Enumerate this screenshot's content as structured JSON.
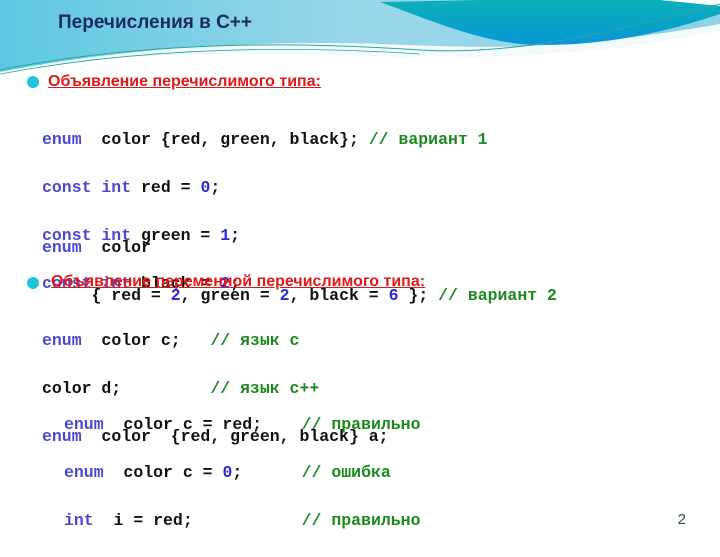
{
  "slide": {
    "title": "Перечисления в С++",
    "page_number": "2",
    "colors": {
      "title": "#1a2a5e",
      "heading": "#e01818",
      "keyword": "#4a4ad0",
      "number": "#2a2ad8",
      "comment": "#1e8a1e",
      "bullet": "#1fc4d8"
    }
  },
  "section1": {
    "heading": " Объявление перечислимого типа:",
    "lines": [
      {
        "kw": "enum",
        "text": "  color {red, green, black}; ",
        "comment": "// вариант 1"
      },
      {
        "kw": "const int",
        "text": " red = ",
        "num": "0",
        "tail": ";"
      },
      {
        "kw": "const int",
        "text": " green = ",
        "num": "1",
        "tail": ";"
      },
      {
        "kw": "const int",
        "text": " black = ",
        "num": "2",
        "tail": ";"
      }
    ],
    "variant2": {
      "kw": "enum",
      "line1": "  color",
      "line2_a": "     { red = ",
      "n1": "2",
      "line2_b": ", green = ",
      "n2": "2",
      "line2_c": ", black = ",
      "n3": "6",
      "line2_d": " }; ",
      "comment": "// вариант 2"
    }
  },
  "section2": {
    "heading": "Объявление переменной перечислимого типа:",
    "lines": [
      {
        "kw": "enum",
        "text": "  color c;   ",
        "comment": "// язык с"
      },
      {
        "kw": "",
        "text": "color d;         ",
        "comment": "// язык с++"
      },
      {
        "kw": "enum",
        "text": "  color  {red, green, black} a;",
        "comment": ""
      }
    ],
    "examples": [
      {
        "kw": "enum",
        "text": "  color c = red;    ",
        "num": "",
        "tail": "",
        "comment": "// правильно"
      },
      {
        "kw": "enum",
        "text": "  color c = ",
        "num": "0",
        "tail": ";      ",
        "comment": "// ошибка"
      },
      {
        "kw": "int",
        "text": "  i = red;           ",
        "num": "",
        "tail": "",
        "comment": "// правильно"
      }
    ]
  }
}
